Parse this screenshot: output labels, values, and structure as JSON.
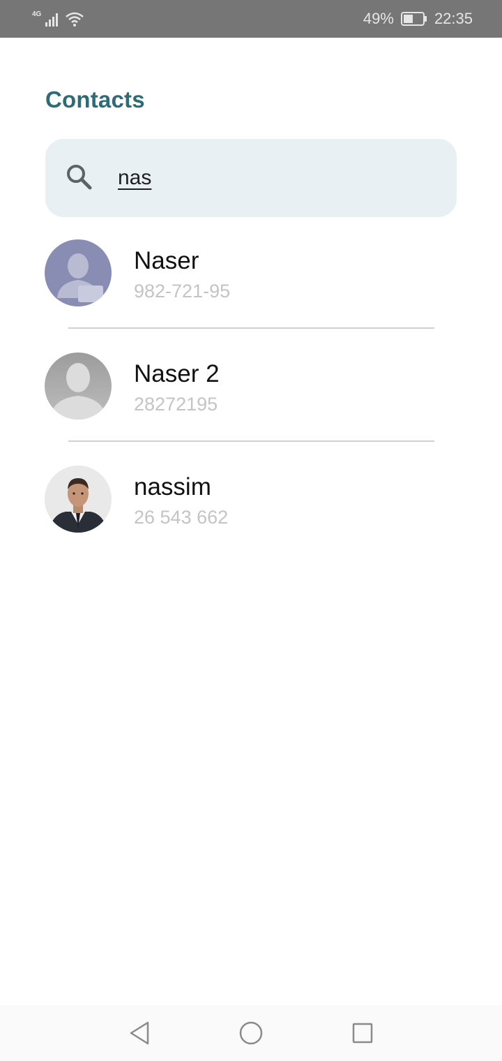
{
  "status_bar": {
    "network": "4G",
    "battery": "49%",
    "time": "22:35",
    "icons": [
      "signal-icon",
      "wifi-icon",
      "battery-icon"
    ]
  },
  "header": {
    "title": "Contacts"
  },
  "search": {
    "value": "nas",
    "icon": "search-icon"
  },
  "contacts": [
    {
      "name": "Naser",
      "phone": "982-721-95",
      "avatar": "default-avatar-purple"
    },
    {
      "name": "Naser 2",
      "phone": "28272195",
      "avatar": "default-avatar-grey"
    },
    {
      "name": "nassim",
      "phone": "26 543 662",
      "avatar": "photo-avatar"
    }
  ],
  "nav": {
    "icons": [
      "back-icon",
      "home-icon",
      "recents-icon"
    ]
  },
  "colors": {
    "accent": "#2d6b78",
    "search_bg": "#e8f0f3",
    "status_bar": "#767676",
    "phone_text": "#c4c4c4"
  }
}
